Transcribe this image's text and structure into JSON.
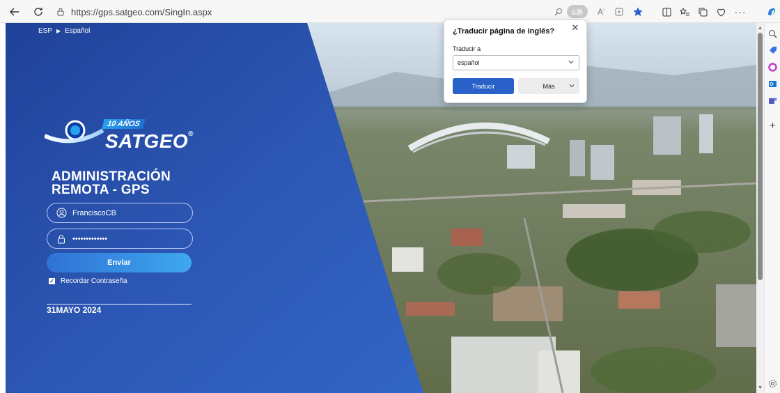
{
  "browser": {
    "url": "https://gps.satgeo.com/SingIn.aspx",
    "reader_badge": "aあ"
  },
  "page": {
    "lang_code": "ESP",
    "lang_arrow": "▶",
    "lang_name": "Español",
    "logo": {
      "badge": "10 AÑOS",
      "brand": "SATGEO",
      "reg": "®"
    },
    "title_line1": "ADMINISTRACIÓN",
    "title_line2": "REMOTA - GPS",
    "username_value": "FranciscoCB",
    "password_value": "•••••••••••••",
    "submit_label": "Enviar",
    "remember_label": "Recordar Contraseña",
    "date_text": "31MAYO 2024"
  },
  "translate_popup": {
    "title": "¿Traducir página de inglés?",
    "label": "Traducir a",
    "selected_language": "español",
    "translate_button": "Traducir",
    "more_button": "Más"
  },
  "colors": {
    "panel_blue": "#1f3f9e",
    "accent_blue": "#2a61c9",
    "favorite_star": "#2b5fcf"
  }
}
